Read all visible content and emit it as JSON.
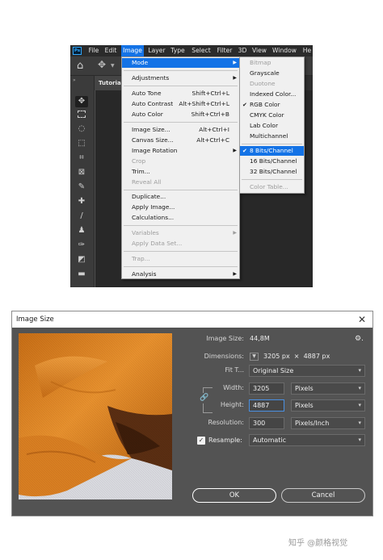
{
  "photoshop": {
    "menubar": [
      "File",
      "Edit",
      "Image",
      "Layer",
      "Type",
      "Select",
      "Filter",
      "3D",
      "View",
      "Window",
      "He"
    ],
    "active_menu": "Image",
    "logo": "Ps",
    "tab": "Tutorial",
    "image_menu": [
      {
        "label": "Mode",
        "highlighted": true,
        "submenu": true
      },
      {
        "label": "Adjustments",
        "submenu": true
      },
      {
        "label": "Auto Tone",
        "shortcut": "Shift+Ctrl+L"
      },
      {
        "label": "Auto Contrast",
        "shortcut": "Alt+Shift+Ctrl+L"
      },
      {
        "label": "Auto Color",
        "shortcut": "Shift+Ctrl+B"
      },
      {
        "label": "Image Size...",
        "shortcut": "Alt+Ctrl+I"
      },
      {
        "label": "Canvas Size...",
        "shortcut": "Alt+Ctrl+C"
      },
      {
        "label": "Image Rotation",
        "submenu": true
      },
      {
        "label": "Crop",
        "disabled": true
      },
      {
        "label": "Trim..."
      },
      {
        "label": "Reveal All",
        "disabled": true
      },
      {
        "label": "Duplicate..."
      },
      {
        "label": "Apply Image..."
      },
      {
        "label": "Calculations..."
      },
      {
        "label": "Variables",
        "disabled": true,
        "submenu": true
      },
      {
        "label": "Apply Data Set...",
        "disabled": true
      },
      {
        "label": "Trap...",
        "disabled": true
      },
      {
        "label": "Analysis",
        "submenu": true
      }
    ],
    "mode_menu": [
      {
        "label": "Bitmap",
        "disabled": true
      },
      {
        "label": "Grayscale"
      },
      {
        "label": "Duotone",
        "disabled": true
      },
      {
        "label": "Indexed Color..."
      },
      {
        "label": "RGB Color",
        "checked": true
      },
      {
        "label": "CMYK Color"
      },
      {
        "label": "Lab Color"
      },
      {
        "label": "Multichannel"
      },
      {
        "label": "8 Bits/Channel",
        "checked": true,
        "highlighted": true
      },
      {
        "label": "16 Bits/Channel"
      },
      {
        "label": "32 Bits/Channel"
      },
      {
        "label": "Color Table...",
        "disabled": true
      }
    ],
    "checkmark": "✔",
    "arrow": "▶"
  },
  "dialog": {
    "title": "Image Size",
    "close": "✕",
    "image_size_label": "Image Size:",
    "image_size_value": "44,8M",
    "gear": "⚙.",
    "dimensions_label": "Dimensions:",
    "dimensions_value": "3205 px  ×  4887 px",
    "fit_label": "Fit T...",
    "fit_value": "Original Size",
    "width_label": "Width:",
    "width_value": "3205",
    "width_unit": "Pixels",
    "height_label": "Height:",
    "height_value": "4887",
    "height_unit": "Pixels",
    "resolution_label": "Resolution:",
    "resolution_value": "300",
    "resolution_unit": "Pixels/Inch",
    "resample_label": "Resample:",
    "resample_checked": true,
    "resample_value": "Automatic",
    "ok_label": "OK",
    "cancel_label": "Cancel"
  },
  "watermark": "知乎 @颜格视觉",
  "colors": {
    "accent": "#1473e6",
    "ps_dark": "#2b2b2b",
    "dialog_bg": "#535353",
    "fabric_orange": "#e0892a"
  }
}
